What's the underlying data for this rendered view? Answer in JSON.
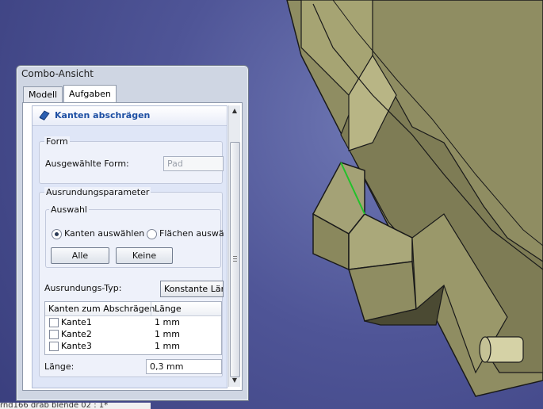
{
  "combo": {
    "title": "Combo-Ansicht",
    "tabs": [
      {
        "label": "Modell",
        "active": false
      },
      {
        "label": "Aufgaben",
        "active": true
      }
    ]
  },
  "task": {
    "title": "Kanten abschrägen",
    "form_group": {
      "legend": "Form",
      "selected_label": "Ausgewählte Form:",
      "selected_value": "Pad"
    },
    "params_group": {
      "legend": "Ausrundungsparameter",
      "selection_group": {
        "legend": "Auswahl",
        "radio_edges": "Kanten auswählen",
        "radio_faces": "Flächen auswä",
        "radio_edges_checked": true,
        "btn_all": "Alle",
        "btn_none": "Keine"
      },
      "type_label": "Ausrundungs-Typ:",
      "type_value": "Konstante Läng",
      "table": {
        "headers": [
          "Kanten zum Abschrägen",
          "Länge"
        ],
        "rows": [
          {
            "name": "Kante1",
            "length": "1 mm",
            "checked": false
          },
          {
            "name": "Kante2",
            "length": "1 mm",
            "checked": false
          },
          {
            "name": "Kante3",
            "length": "1 mm",
            "checked": false
          }
        ]
      },
      "length_label": "Länge:",
      "length_value": "0,3 mm"
    }
  },
  "taskbar": {
    "tab_label": "rnd166 drab blende 02 : 1*"
  },
  "colors": {
    "viewport_bg": "#4f5597",
    "model_face": "#9c9a6c",
    "highlight_edge": "#22c12a",
    "task_title": "#1d4fa3"
  }
}
